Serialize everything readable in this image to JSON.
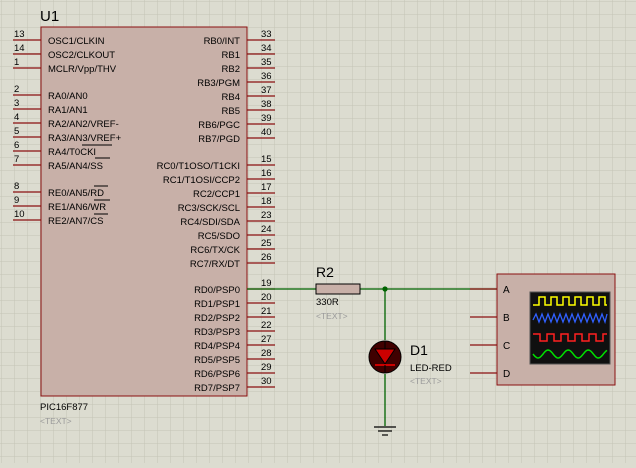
{
  "canvas": {
    "background": "#dcdcd0",
    "grid_color": "#c4c4b6",
    "body_color": "#c8b0a8",
    "outline_color": "#8a1010",
    "wire_color": "#006400",
    "text_color": "#000000",
    "hint_color": "#9a9a9a"
  },
  "ic": {
    "ref": "U1",
    "part": "PIC16F877",
    "text_hint": "<TEXT>",
    "left_pins": [
      {
        "num": "13",
        "label": "OSC1/CLKIN"
      },
      {
        "num": "14",
        "label": "OSC2/CLKOUT"
      },
      {
        "num": "1",
        "label": "MCLR/Vpp/THV"
      },
      {
        "num": "2",
        "label": "RA0/AN0"
      },
      {
        "num": "3",
        "label": "RA1/AN1"
      },
      {
        "num": "4",
        "label": "RA2/AN2/VREF-"
      },
      {
        "num": "5",
        "label": "RA3/AN3/VREF+"
      },
      {
        "num": "6",
        "label": "RA4/T0CKI"
      },
      {
        "num": "7",
        "label": "RA5/AN4/SS"
      },
      {
        "num": "8",
        "label": "RE0/AN5/RD"
      },
      {
        "num": "9",
        "label": "RE1/AN6/WR"
      },
      {
        "num": "10",
        "label": "RE2/AN7/CS"
      }
    ],
    "right_pins": [
      {
        "num": "33",
        "label": "RB0/INT"
      },
      {
        "num": "34",
        "label": "RB1"
      },
      {
        "num": "35",
        "label": "RB2"
      },
      {
        "num": "36",
        "label": "RB3/PGM"
      },
      {
        "num": "37",
        "label": "RB4"
      },
      {
        "num": "38",
        "label": "RB5"
      },
      {
        "num": "39",
        "label": "RB6/PGC"
      },
      {
        "num": "40",
        "label": "RB7/PGD"
      },
      {
        "num": "15",
        "label": "RC0/T1OSO/T1CKI"
      },
      {
        "num": "16",
        "label": "RC1/T1OSI/CCP2"
      },
      {
        "num": "17",
        "label": "RC2/CCP1"
      },
      {
        "num": "18",
        "label": "RC3/SCK/SCL"
      },
      {
        "num": "23",
        "label": "RC4/SDI/SDA"
      },
      {
        "num": "24",
        "label": "RC5/SDO"
      },
      {
        "num": "25",
        "label": "RC6/TX/CK"
      },
      {
        "num": "26",
        "label": "RC7/RX/DT"
      },
      {
        "num": "19",
        "label": "RD0/PSP0"
      },
      {
        "num": "20",
        "label": "RD1/PSP1"
      },
      {
        "num": "21",
        "label": "RD2/PSP2"
      },
      {
        "num": "22",
        "label": "RD3/PSP3"
      },
      {
        "num": "27",
        "label": "RD4/PSP4"
      },
      {
        "num": "28",
        "label": "RD5/PSP5"
      },
      {
        "num": "29",
        "label": "RD6/PSP6"
      },
      {
        "num": "30",
        "label": "RD7/PSP7"
      }
    ]
  },
  "resistor": {
    "ref": "R2",
    "value": "330R",
    "text_hint": "<TEXT>"
  },
  "led": {
    "ref": "D1",
    "value": "LED-RED",
    "text_hint": "<TEXT>",
    "color": "#cc0000"
  },
  "scope": {
    "channels": [
      "A",
      "B",
      "C",
      "D"
    ],
    "trace_colors": [
      "#ffff00",
      "#3060ff",
      "#ff2020",
      "#00e000"
    ],
    "screen_color": "#101010"
  }
}
